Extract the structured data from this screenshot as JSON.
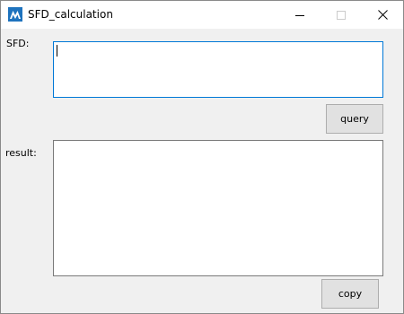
{
  "window": {
    "title": "SFD_calculation",
    "icon": "app-logo-icon",
    "controls": {
      "minimize_icon": "minimize-icon",
      "maximize_icon": "maximize-icon",
      "close_icon": "close-icon"
    }
  },
  "form": {
    "sfd_label": "SFD:",
    "sfd_value": "",
    "query_label": "query",
    "result_label": "result:",
    "result_value": "",
    "copy_label": "copy"
  },
  "colors": {
    "icon_blue": "#1e73be",
    "focus_border": "#0078d7",
    "window_bg": "#f0f0f0",
    "button_bg": "#e1e1e1"
  }
}
